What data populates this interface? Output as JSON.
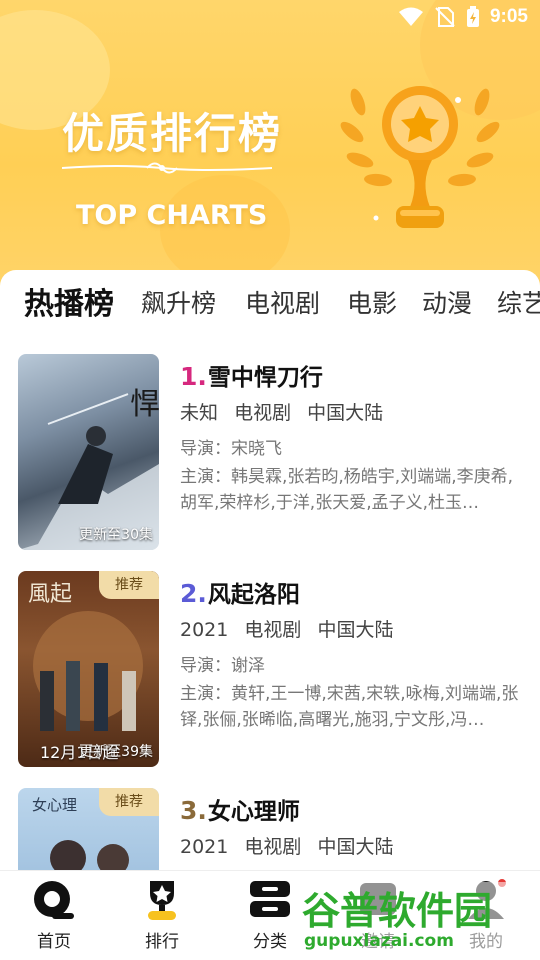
{
  "status": {
    "time": "9:05"
  },
  "banner": {
    "title": "优质排行榜",
    "subtitle": "TOP CHARTS"
  },
  "tabs": [
    "热播榜",
    "飙升榜",
    "电视剧",
    "电影",
    "动漫",
    "综艺"
  ],
  "items": [
    {
      "rank": "1.",
      "rank_color": "#d6287e",
      "title": "雪中悍刀行",
      "meta": [
        "未知",
        "电视剧",
        "中国大陆"
      ],
      "director": "导演：宋晓飞",
      "cast": "主演：韩昊霖,张若昀,杨皓宇,刘端端,李庚希,胡军,荣梓杉,于洋,张天爱,孟子义,杜玉…",
      "poster_label": "更新至30集",
      "badge": ""
    },
    {
      "rank": "2.",
      "rank_color": "#5b5bd6",
      "title": "风起洛阳",
      "meta": [
        "2021",
        "电视剧",
        "中国大陆"
      ],
      "director": "导演：谢泽",
      "cast": "主演：黄轩,王一博,宋茜,宋轶,咏梅,刘端端,张铎,张俪,张晞临,高曙光,施羽,宁文彤,冯…",
      "poster_label": "更新至39集",
      "poster_date": "12月1日起",
      "badge": "推荐"
    },
    {
      "rank": "3.",
      "rank_color": "#8a6a3a",
      "title": "女心理师",
      "meta": [
        "2021",
        "电视剧",
        "中国大陆"
      ],
      "director": "",
      "cast": "",
      "poster_label": "",
      "badge": "推荐"
    }
  ],
  "nav": [
    {
      "label": "首页",
      "icon": "home-icon"
    },
    {
      "label": "排行",
      "icon": "trophy-icon"
    },
    {
      "label": "分类",
      "icon": "category-icon"
    },
    {
      "label": "邀请",
      "icon": "invite-icon"
    },
    {
      "label": "我的",
      "icon": "profile-icon"
    }
  ],
  "watermark": {
    "text": "谷普软件园",
    "url": "gupuxlazai.com"
  }
}
